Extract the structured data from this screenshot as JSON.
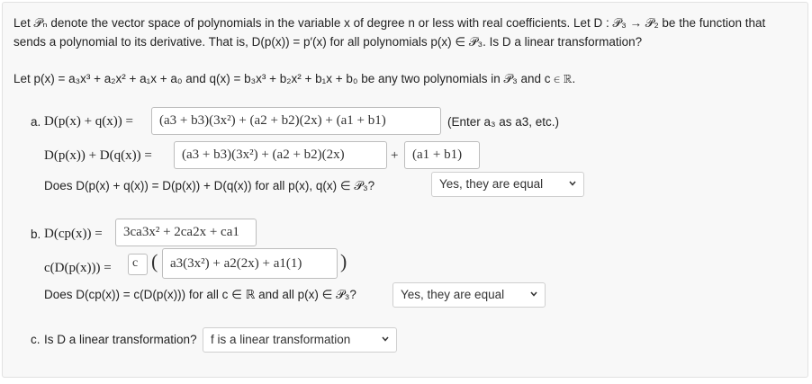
{
  "intro": {
    "line1": "Let 𝒫ₙ denote the vector space of polynomials in the variable x of degree n or less with real coefficients. Let D : 𝒫₃ → 𝒫₂ be the function that",
    "line2": "sends a polynomial to its derivative. That is, D(p(x)) = p′(x) for all polynomials p(x) ∈ 𝒫₃. Is D a linear transformation?",
    "line3": "Let p(x) = a₃x³ + a₂x² + a₁x + a₀ and q(x) = b₃x³ + b₂x² + b₁x + b₀ be any two polynomials in 𝒫₃ and c ∈ ℝ."
  },
  "part_a": {
    "label": "a.",
    "lhs1": "D(p(x) + q(x)) =",
    "answer1": "(a3 + b3)(3x²) + (a2 + b2)(2x) + (a1 + b1)",
    "hint": "(Enter a₃ as a3, etc.)",
    "lhs2": "D(p(x)) + D(q(x)) =",
    "answer2a": "(a3 + b3)(3x²) + (a2 + b2)(2x)",
    "plus": "+",
    "answer2b": "(a1 + b1)",
    "question": "Does D(p(x) + q(x)) = D(p(x)) + D(q(x)) for all p(x), q(x) ∈ 𝒫₃?",
    "select_value": "Yes, they are equal"
  },
  "part_b": {
    "label": "b.",
    "lhs1": "D(cp(x)) =",
    "answer1": "3ca3x² + 2ca2x + ca1",
    "lhs2": "c(D(p(x))) =",
    "answer_c": "c",
    "answer2": "a3(3x²) + a2(2x) + a1(1)",
    "question": "Does D(cp(x)) = c(D(p(x))) for all c ∈ ℝ and all p(x) ∈ 𝒫₃?",
    "select_value": "Yes, they are equal"
  },
  "part_c": {
    "label": "c.",
    "question": "Is D a linear transformation?",
    "select_value": "f is a linear transformation"
  },
  "icons": {
    "dropdown": "chevron-down-icon"
  }
}
